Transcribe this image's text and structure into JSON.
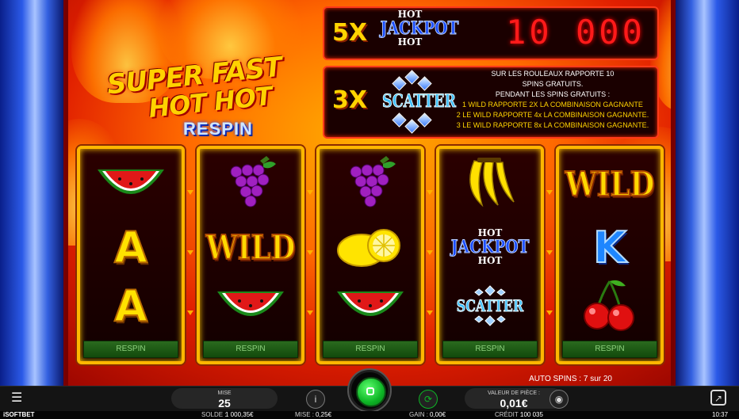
{
  "game": {
    "logo_line1": "SUPER FAST",
    "logo_line2": "HOT HOT",
    "logo_line3": "RESPIN"
  },
  "jackpot_panel": {
    "multiplier": "5X",
    "symbol_hot_top": "HOT",
    "symbol_word": "JACKPOT",
    "symbol_hot_bottom": "HOT",
    "amount": "10 000"
  },
  "scatter_panel": {
    "multiplier": "3X",
    "symbol_word": "SCATTER",
    "line1": "SUR LES ROULEAUX RAPPORTE 10",
    "line2": "SPINS GRATUITS.",
    "line3": "PENDANT LES SPINS GRATUITS :",
    "line4": "1 WILD RAPPORTE 2X LA COMBINAISON GAGNANTE",
    "line5": "2 LE WILD RAPPORTE 4x LA COMBINAISON GAGNANTE.",
    "line6": "3 LE WILD RAPPORTE 8x LA COMBINAISON GAGNANTE."
  },
  "reels": [
    {
      "symbols": [
        "watermelon",
        "A",
        "A"
      ],
      "respin_label": "RESPIN"
    },
    {
      "symbols": [
        "grapes",
        "WILD",
        "watermelon"
      ],
      "respin_label": "RESPIN"
    },
    {
      "symbols": [
        "grapes",
        "lemon",
        "watermelon"
      ],
      "respin_label": "RESPIN"
    },
    {
      "symbols": [
        "banana",
        "jackpot",
        "scatter"
      ],
      "respin_label": "RESPIN"
    },
    {
      "symbols": [
        "WILD",
        "K",
        "cherries"
      ],
      "respin_label": "RESPIN"
    }
  ],
  "symbol_text": {
    "a": "A",
    "k": "K",
    "wild": "WILD",
    "hot": "HOT",
    "jackpot": "JACKPOT",
    "scatter": "SCATTER"
  },
  "auto_spins": "AUTO SPINS : 7 sur 20",
  "hud": {
    "bet_label": "MISE",
    "bet_value": "25",
    "coin_label": "VALEUR DE PIÈCE :",
    "coin_value": "0,01€",
    "info_icon": "info-icon",
    "autoplay_icon": "autoplay-icon",
    "coins_icon": "coins-icon",
    "menu_icon": "menu-icon",
    "exit_icon": "exit-icon",
    "spin_icon": "stop-spin-icon"
  },
  "status_bar": {
    "brand": "iSOFTBET",
    "balance_label": "SOLDE :",
    "balance_value": "1 000,35€",
    "bet_label": "MISE :",
    "bet_value": "0,25€",
    "win_label": "GAIN :",
    "win_value": "0,00€",
    "credit_label": "CRÉDIT :",
    "credit_value": "100 035",
    "time": "10:37"
  },
  "colors": {
    "accent_gold": "#ffb700",
    "spin_green": "#0db425",
    "respin_green": "#2a6a1e",
    "jackpot_red": "#ff1a1a"
  }
}
